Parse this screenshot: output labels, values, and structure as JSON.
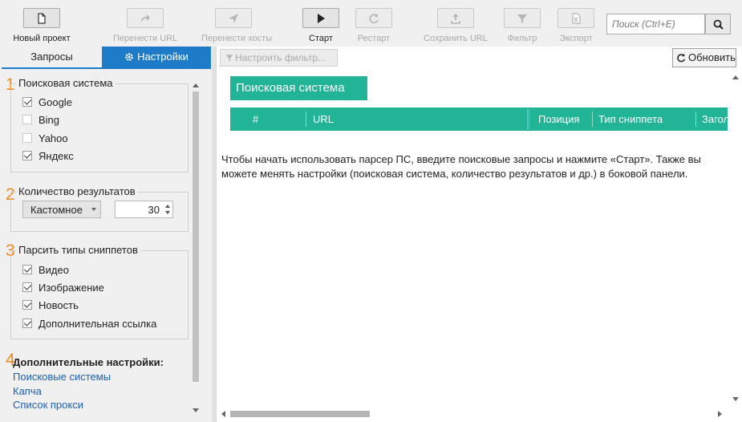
{
  "toolbar": {
    "new_project": "Новый проект",
    "transfer_url": "Перенести URL",
    "transfer_hosts": "Перенести хосты",
    "start": "Старт",
    "restart": "Рестарт",
    "save_url": "Сохранить URL",
    "filter": "Фильтр",
    "export": "Экспорт"
  },
  "search": {
    "placeholder": "Поиск (Ctrl+E)"
  },
  "tabs": {
    "requests": "Запросы",
    "settings": "Настройки"
  },
  "groups": {
    "search_engine": {
      "num": "1",
      "title": "Поисковая система",
      "items": [
        {
          "label": "Google",
          "checked": true
        },
        {
          "label": "Bing",
          "checked": false
        },
        {
          "label": "Yahoo",
          "checked": false
        },
        {
          "label": "Яндекс",
          "checked": true
        }
      ]
    },
    "results_count": {
      "num": "2",
      "title": "Количество результатов",
      "mode": "Кастомное",
      "value": "30"
    },
    "snippet_types": {
      "num": "3",
      "title": "Парсить типы сниппетов",
      "items": [
        {
          "label": "Видео",
          "checked": true
        },
        {
          "label": "Изображение",
          "checked": true
        },
        {
          "label": "Новость",
          "checked": true
        },
        {
          "label": "Дополнительная ссылка",
          "checked": true
        }
      ]
    },
    "advanced": {
      "num": "4",
      "title": "Дополнительные настройки:",
      "links": [
        "Поисковые системы",
        "Капча",
        "Список прокси"
      ]
    }
  },
  "right": {
    "filter_button": "Настроить фильтр...",
    "refresh_button": "Обновить",
    "engine_header": "Поисковая система",
    "columns": [
      "#",
      "URL",
      "Позиция",
      "Тип сниппета",
      "Заголовок"
    ],
    "info": "Чтобы начать использовать парсер ПС, введите поисковые запросы и нажмите «Старт». Также вы можете менять настройки (поисковая система, количество результатов и др.) в боковой панели."
  },
  "colors": {
    "accent": "#1e7bc8",
    "table_header": "#21b497",
    "section_number": "#f08a24",
    "link": "#1a5fb4"
  }
}
